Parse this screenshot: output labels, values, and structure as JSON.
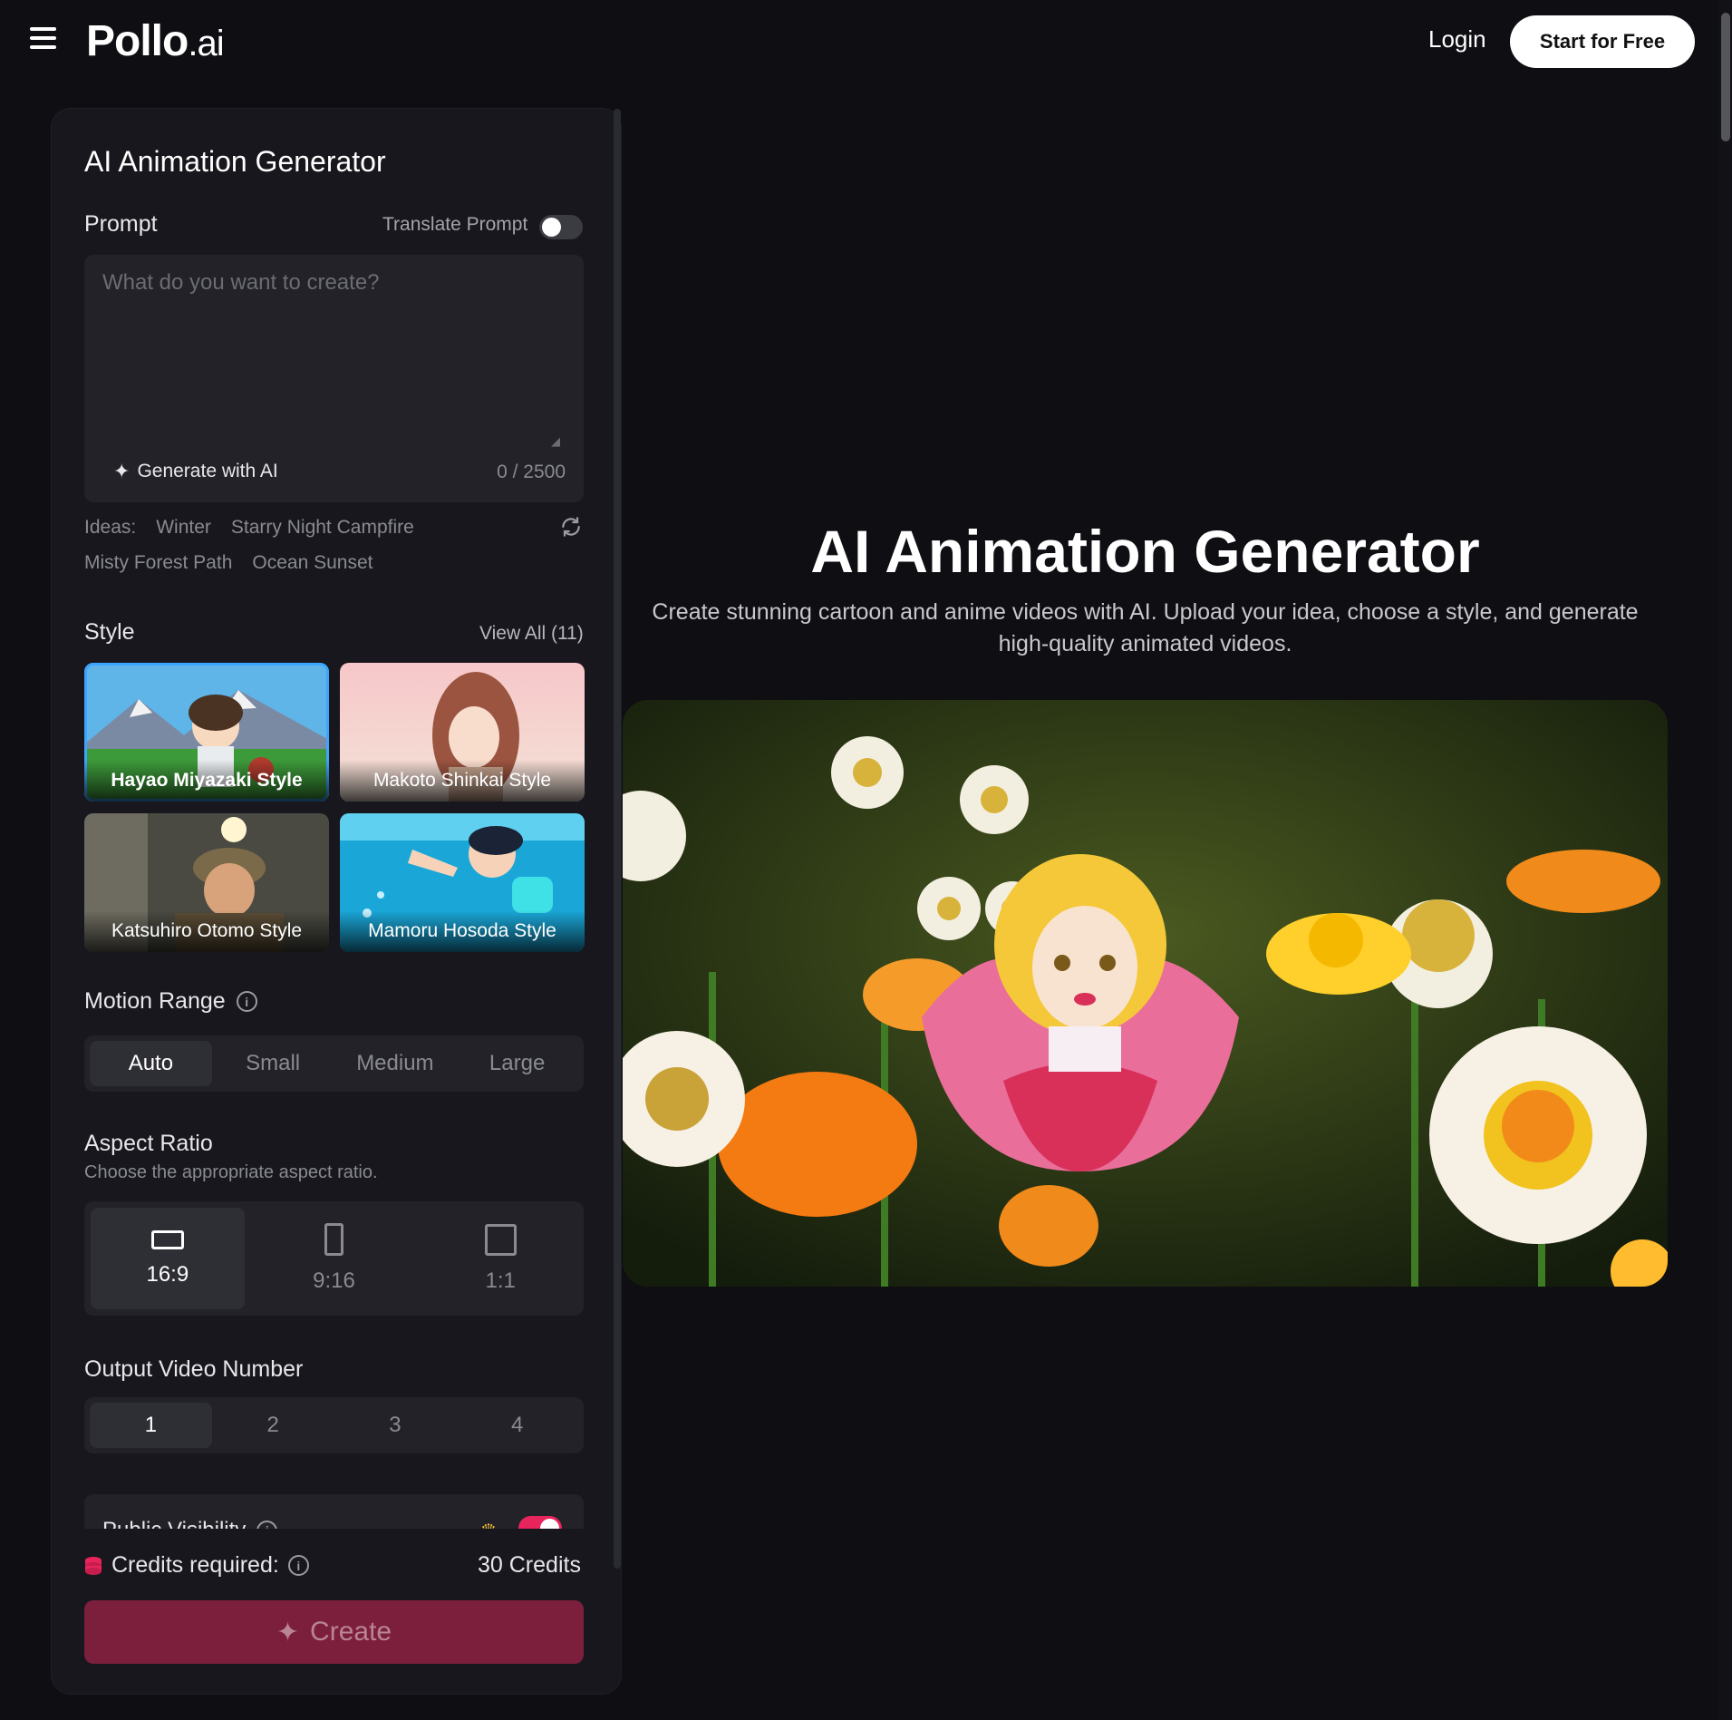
{
  "header": {
    "logo_main": "Pollo",
    "logo_suffix": ".ai",
    "login_label": "Login",
    "start_label": "Start for Free"
  },
  "panel": {
    "title": "AI Animation Generator",
    "prompt": {
      "label": "Prompt",
      "translate_label": "Translate Prompt",
      "translate_on": false,
      "placeholder": "What do you want to create?",
      "value": "",
      "generate_label": "Generate with AI",
      "counter": "0 / 2500"
    },
    "ideas": {
      "label": "Ideas:",
      "items": [
        "Winter",
        "Starry Night Campfire",
        "Misty Forest Path",
        "Ocean Sunset"
      ]
    },
    "style": {
      "label": "Style",
      "view_all": "View All (11)",
      "cards": [
        {
          "label": "Hayao Miyazaki Style",
          "selected": true
        },
        {
          "label": "Makoto Shinkai Style",
          "selected": false
        },
        {
          "label": "Katsuhiro Otomo Style",
          "selected": false
        },
        {
          "label": "Mamoru Hosoda Style",
          "selected": false
        }
      ]
    },
    "motion": {
      "label": "Motion Range",
      "options": [
        "Auto",
        "Small",
        "Medium",
        "Large"
      ],
      "selected": "Auto"
    },
    "aspect": {
      "label": "Aspect Ratio",
      "sublabel": "Choose the appropriate aspect ratio.",
      "options": [
        "16:9",
        "9:16",
        "1:1"
      ],
      "selected": "16:9"
    },
    "output": {
      "label": "Output Video Number",
      "options": [
        "1",
        "2",
        "3",
        "4"
      ],
      "selected": "1"
    },
    "visibility": {
      "label": "Public Visibility",
      "on": true
    },
    "credits": {
      "label": "Credits required:",
      "value": "30 Credits"
    },
    "create_label": "Create"
  },
  "hero": {
    "title": "AI Animation Generator",
    "subtitle": "Create stunning cartoon and anime videos with AI. Upload your idea, choose a style, and generate high-quality animated videos."
  },
  "colors": {
    "background": "#0e0e13",
    "panel": "#17171d",
    "accent": "#e8245c",
    "create_button": "#7c1f3d",
    "selected_outline": "#3ea5ff"
  }
}
